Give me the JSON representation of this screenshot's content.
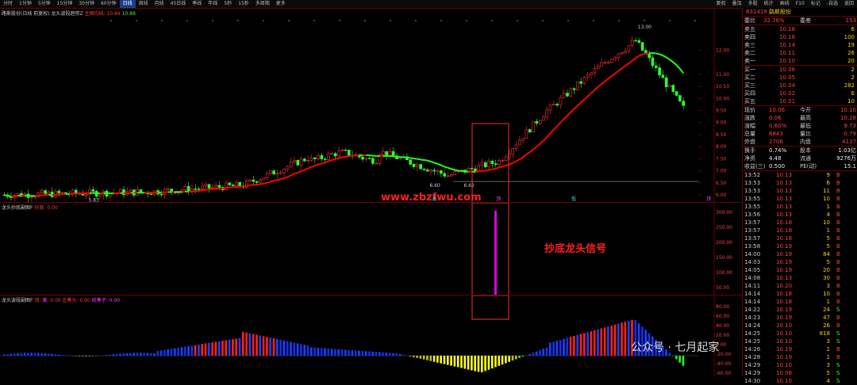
{
  "topbar": {
    "periods": [
      "分时",
      "1分钟",
      "5分钟",
      "15分钟",
      "30分钟",
      "60分钟",
      "日线",
      "周线",
      "月线",
      "45日线",
      "季线",
      "年线",
      "5秒",
      "15秒",
      "多周期",
      "更多"
    ],
    "active": "日线",
    "right_buttons": [
      "复权",
      "叠加",
      "多股",
      "统计",
      "画线",
      "F10",
      "标记",
      "-自选",
      "返回"
    ]
  },
  "main_chart": {
    "title": "路斯股份(日线 前复权)",
    "indicator": "龙头波段趋势Z",
    "indicator_value": "主图均线: 10.89",
    "indicator_value2": "10.89",
    "price_high_label": "13.00",
    "price_low_label": "6.60",
    "price_low_label2": "6.62",
    "price_start_label": "5.83",
    "y_axis": [
      "12.00",
      "11.00",
      "10.50",
      "10.00",
      "9.50",
      "9.00",
      "8.50",
      "8.00",
      "7.50",
      "7.00",
      "6.50",
      "6.00"
    ],
    "markers": [
      {
        "text": "底"
      },
      {
        "text": "顶"
      },
      {
        "text": "低"
      },
      {
        "text": "顶"
      }
    ],
    "watermark": "www.zbzfwu.com",
    "colors": {
      "up": "#ff3030",
      "down": "#30ff30",
      "ma": "#ff0000",
      "ma_down": "#20ff20"
    }
  },
  "chart2": {
    "title": "龙头抄底副图F",
    "label": "抄底: 0.00",
    "y_axis": [
      "300.00",
      "250.00",
      "200.00",
      "150.00",
      "100.00",
      "50.00"
    ],
    "annotation": "抄底龙头信号"
  },
  "chart3": {
    "title": "龙头波段副图F",
    "labels": [
      "顶: ",
      "黄: ",
      "0.00",
      "庄筹头: 0.00",
      "底筹子: 0.00"
    ],
    "y_axis": [
      "80.00",
      "60.00",
      "40.00",
      "20.00",
      "0.00",
      "-20.00",
      "-40.00",
      "-60.00"
    ],
    "wechat_watermark": "公众号 · 七月起家"
  },
  "quote_panel": {
    "code": "832419",
    "name": "路斯股份",
    "weibi_label": "委比",
    "weibi": "32.76%",
    "weicha_label": "委差",
    "weicha": "153",
    "asks": [
      {
        "label": "卖五",
        "price": "10.18",
        "vol": "6"
      },
      {
        "label": "卖四",
        "price": "10.16",
        "vol": "100"
      },
      {
        "label": "卖三",
        "price": "10.14",
        "vol": "19"
      },
      {
        "label": "卖二",
        "price": "10.11",
        "vol": "26"
      },
      {
        "label": "卖一",
        "price": "10.10",
        "vol": "20"
      }
    ],
    "bids": [
      {
        "label": "买一",
        "price": "10.06",
        "vol": "2"
      },
      {
        "label": "买二",
        "price": "10.05",
        "vol": "2"
      },
      {
        "label": "买三",
        "price": "10.04",
        "vol": "282"
      },
      {
        "label": "买四",
        "price": "10.02",
        "vol": "6"
      },
      {
        "label": "买五",
        "price": "10.01",
        "vol": "10"
      }
    ],
    "stats": [
      {
        "l1": "现价",
        "v1": "10.06",
        "l2": "今开",
        "v2": "10.10"
      },
      {
        "l1": "涨跌",
        "v1": "0.06",
        "l2": "最高",
        "v2": "10.28"
      },
      {
        "l1": "涨幅",
        "v1": "0.60%",
        "l2": "最低",
        "v2": "9.73"
      },
      {
        "l1": "总量",
        "v1": "6843",
        "l2": "量比",
        "v2": "0.79"
      },
      {
        "l1": "外盘",
        "v1": "2706",
        "l2": "内盘",
        "v2": "4137"
      }
    ],
    "fin": [
      {
        "l1": "换手",
        "v1": "0.74%",
        "l2": "股本",
        "v2": "1.03亿"
      },
      {
        "l1": "净资",
        "v1": "4.48",
        "l2": "流通",
        "v2": "9276万"
      },
      {
        "l1": "收益(三)",
        "v1": "0.500",
        "l2": "PE(动)",
        "v2": "15.1"
      }
    ],
    "ticks": [
      {
        "t": "13:52",
        "p": "10.13",
        "q": "9",
        "f": "B"
      },
      {
        "t": "13:53",
        "p": "10.13",
        "q": "6",
        "f": "B"
      },
      {
        "t": "13:53",
        "p": "10.13",
        "q": "11",
        "f": "B"
      },
      {
        "t": "13:55",
        "p": "10.13",
        "q": "10",
        "f": "B"
      },
      {
        "t": "13:55",
        "p": "10.13",
        "q": "1",
        "f": "B"
      },
      {
        "t": "13:56",
        "p": "10.13",
        "q": "4",
        "f": "B"
      },
      {
        "t": "13:57",
        "p": "10.18",
        "q": "10",
        "f": "B"
      },
      {
        "t": "13:57",
        "p": "10.18",
        "q": "1",
        "f": "B"
      },
      {
        "t": "13:57",
        "p": "10.18",
        "q": "5",
        "f": "B"
      },
      {
        "t": "13:58",
        "p": "10.19",
        "q": "5",
        "f": "B"
      },
      {
        "t": "14:00",
        "p": "10.19",
        "q": "84",
        "f": "B"
      },
      {
        "t": "14:03",
        "p": "10.19",
        "q": "5",
        "f": "B"
      },
      {
        "t": "14:05",
        "p": "10.19",
        "q": "20",
        "f": "B"
      },
      {
        "t": "14:08",
        "p": "10.13",
        "q": "30",
        "f": "B"
      },
      {
        "t": "14:11",
        "p": "10.20",
        "q": "3",
        "f": "B"
      },
      {
        "t": "14:14",
        "p": "10.18",
        "q": "10",
        "f": "B"
      },
      {
        "t": "14:14",
        "p": "10.18",
        "q": "1",
        "f": "B"
      },
      {
        "t": "14:22",
        "p": "10.19",
        "q": "24",
        "f": "S"
      },
      {
        "t": "14:23",
        "p": "10.19",
        "q": "47",
        "f": "B"
      },
      {
        "t": "14:24",
        "p": "10.10",
        "q": "26",
        "f": "B"
      },
      {
        "t": "14:25",
        "p": "10.10",
        "q": "818",
        "f": "S"
      },
      {
        "t": "14:25",
        "p": "10.10",
        "q": "3",
        "f": "S"
      },
      {
        "t": "14:26",
        "p": "10.19",
        "q": "1",
        "f": "B"
      },
      {
        "t": "14:28",
        "p": "10.19",
        "q": "1",
        "f": "B"
      },
      {
        "t": "14:29",
        "p": "10.10",
        "q": "3",
        "f": "S"
      },
      {
        "t": "14:29",
        "p": "10.06",
        "q": "5",
        "f": "S"
      },
      {
        "t": "14:30",
        "p": "10.10",
        "q": "4",
        "f": "S"
      }
    ]
  }
}
